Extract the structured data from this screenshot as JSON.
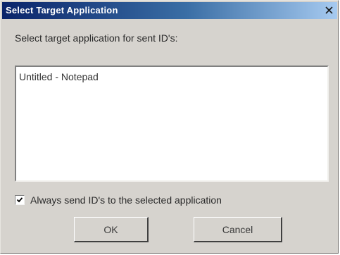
{
  "window": {
    "title": "Select Target Application",
    "close_glyph": "close-icon"
  },
  "dialog": {
    "prompt": "Select target application for sent ID's:",
    "list_items": [
      "Untitled - Notepad"
    ],
    "checkbox": {
      "label": "Always send ID's to the selected application",
      "checked": true
    },
    "buttons": {
      "ok": "OK",
      "cancel": "Cancel"
    }
  },
  "colors": {
    "titlebar_start": "#0a246a",
    "titlebar_end": "#a6caf0",
    "dialog_face": "#d6d3ce",
    "list_background": "#ffffff"
  }
}
